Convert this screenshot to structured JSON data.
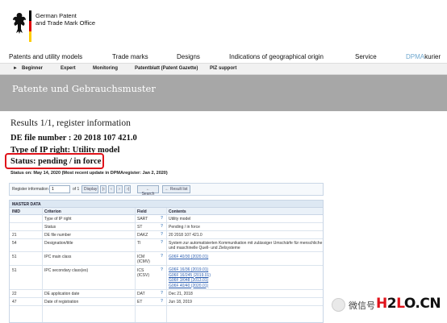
{
  "header": {
    "office_line1": "German Patent",
    "office_line2": "and Trade Mark Office",
    "flag_colors": [
      "#000000",
      "#dd0000",
      "#ffcc00"
    ]
  },
  "mainnav": {
    "items": [
      "Patents and utility models",
      "Trade marks",
      "Designs",
      "Indications of geographical origin",
      "Service"
    ],
    "dpma_prefix": "DPMA",
    "dpma_suffix": "kurier"
  },
  "subnav": {
    "arrow": "►",
    "items": [
      "Beginner",
      "Expert",
      "Monitoring",
      "Patentblatt (Patent Gazette)",
      "PIZ support"
    ]
  },
  "banner": {
    "title": "Patente und Gebrauchsmuster"
  },
  "results": {
    "title": "Results 1/1, register information",
    "file_number": "DE file number : 20 2018 107 421.0",
    "ip_type": "Type of IP right: Utility model",
    "status": "Status: pending / in force",
    "status_detail": "Status on: May 14, 2020 (Most recent update in DPMAregister: Jan 2, 2020)"
  },
  "toolbar": {
    "label": "Register information",
    "page_value": "1",
    "of_label": "of 1",
    "display_button": "Display",
    "nav_first": "|‹",
    "nav_prev": "‹",
    "nav_next": "›",
    "nav_last": "›|",
    "search_button": "← Search",
    "result_list_button": "← Result list"
  },
  "table": {
    "section_title": "MASTER DATA",
    "columns": [
      "INID",
      "Criterion",
      "Field",
      "Contents"
    ],
    "help_mark": "?",
    "rows": [
      {
        "inid": "",
        "criterion": "Type of IP right",
        "field": "SART",
        "contents": [
          "Utility model"
        ]
      },
      {
        "inid": "",
        "criterion": "Status",
        "field": "ST",
        "contents": [
          "Pending / in force"
        ]
      },
      {
        "inid": "21",
        "criterion": "DE file number",
        "field": "DAKZ",
        "contents": [
          "20 2018 107 421.0"
        ]
      },
      {
        "inid": "54",
        "criterion": "Designation/title",
        "field": "TI",
        "contents": [
          "System zur automatisierten Kommunikation mit zulässiger Umschärfe für menschliche",
          "und maschinelle Quell- und Zielsysteme"
        ]
      },
      {
        "inid": "51",
        "criterion": "IPC main class",
        "field": "ICM",
        "field2": "(ICMV)",
        "contents": [
          "G06F 40/30 (2020.01)"
        ],
        "link": true
      },
      {
        "inid": "51",
        "criterion": "IPC secondary class(es)",
        "field": "ICS",
        "field2": "(ICSV)",
        "contents": [
          "G06F 16/36 (2019.01)",
          "G06F 16/245 (2019.01)",
          "G06F 3/048 (2013.01)",
          "G06F 40/40 (2020.01)"
        ],
        "link": true
      },
      {
        "inid": "22",
        "criterion": "DE application date",
        "field": "DAT",
        "contents": [
          "Dec 21, 2018"
        ]
      },
      {
        "inid": "47",
        "criterion": "Date of registration",
        "field": "ET",
        "contents": [
          "Jun 18, 2019"
        ]
      }
    ]
  },
  "watermark": {
    "cn_text": "微信号",
    "logo_red_1": "H",
    "logo_black": "2",
    "logo_red_2": "L",
    "logo_tail": "O.CN"
  }
}
